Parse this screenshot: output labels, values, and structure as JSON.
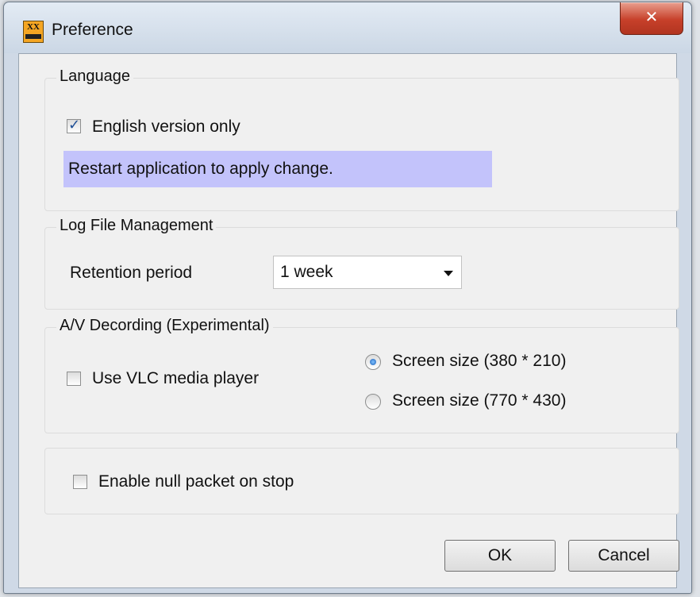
{
  "window": {
    "title": "Preference",
    "app_icon_text": "XX",
    "close_glyph": "✕"
  },
  "language": {
    "group_title": "Language",
    "english_only_label": "English version only",
    "english_only_checked": true,
    "notice": "Restart application to apply change.",
    "notice_color": "#c3c3fb"
  },
  "log": {
    "group_title": "Log File Management",
    "retention_label": "Retention period",
    "retention_value": "1 week"
  },
  "av": {
    "group_title": "A/V Decording (Experimental)",
    "vlc_label": "Use VLC media player",
    "vlc_checked": false,
    "screen_options": [
      {
        "label": "Screen size (380 * 210)",
        "selected": true
      },
      {
        "label": "Screen size (770 * 430)",
        "selected": false
      }
    ]
  },
  "misc": {
    "null_packet_label": "Enable null packet on stop",
    "null_packet_checked": false
  },
  "buttons": {
    "ok": "OK",
    "cancel": "Cancel"
  }
}
